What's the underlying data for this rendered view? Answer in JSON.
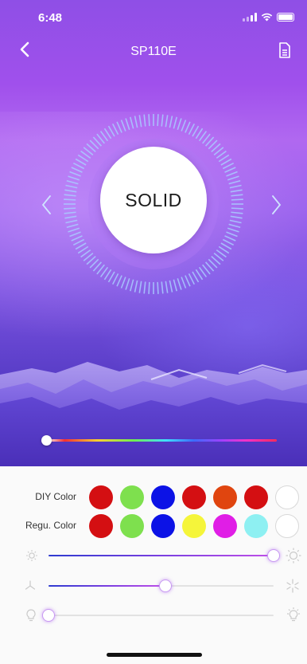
{
  "status_bar": {
    "time": "6:48"
  },
  "header": {
    "title": "SP110E"
  },
  "mode": {
    "label": "SOLID"
  },
  "spectrum": {
    "hue_position": 0.0
  },
  "color_rows": [
    {
      "label": "DIY Color",
      "swatches": [
        "#d40f12",
        "#7ee04e",
        "#0c12e6",
        "#d40f12",
        "#e0450f",
        "#d40f12",
        "empty"
      ]
    },
    {
      "label": "Regu. Color",
      "swatches": [
        "#d40f12",
        "#7ee04e",
        "#0c12e6",
        "#f5f53a",
        "#e01ee6",
        "#8ef0f2",
        "empty"
      ]
    }
  ],
  "sliders": {
    "brightness": {
      "value": 1.0,
      "icon_left": "sun-small-icon",
      "icon_right": "sun-large-icon"
    },
    "speed": {
      "value": 0.52,
      "icon_left": "fan-small-icon",
      "icon_right": "fan-large-icon"
    },
    "white": {
      "value": 0.0,
      "icon_left": "bulb-icon",
      "icon_right": "bulb-glow-icon"
    }
  },
  "colors": {
    "accent": "#8a4df0",
    "panel_bg": "#fafafa",
    "knob_glow": "#c89af2"
  }
}
